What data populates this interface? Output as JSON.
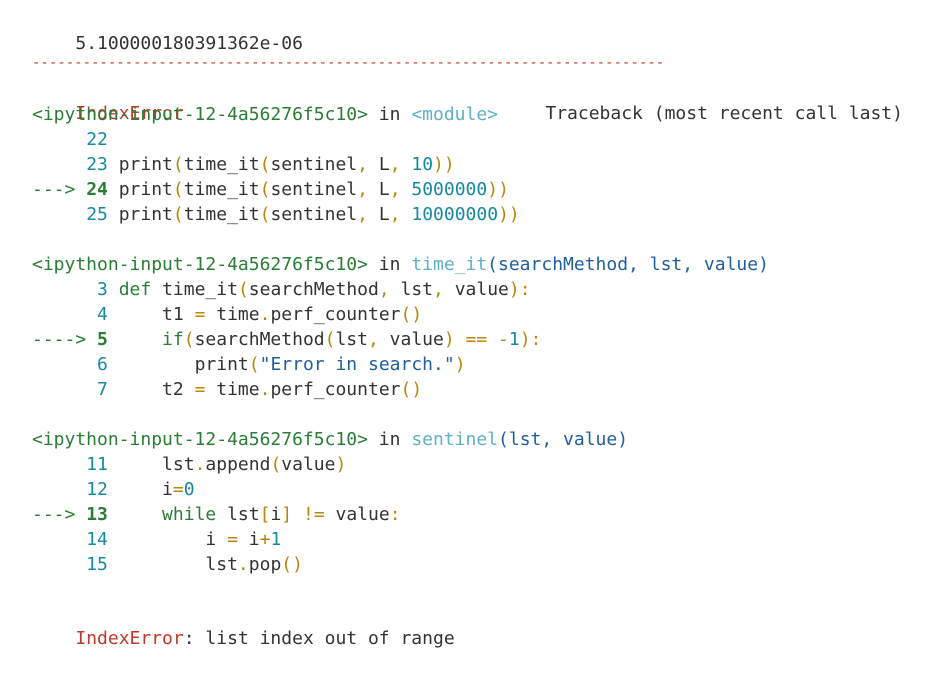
{
  "output": {
    "value": "5.100000180391362e-06"
  },
  "separator": "---------------------------------------------------------------------------",
  "traceback_header": {
    "error_type": "IndexError",
    "title": "Traceback (most recent call last)"
  },
  "frames": [
    {
      "location_line": {
        "cell": "<ipython-input-12-4a56276f5c10>",
        "in": " in ",
        "func": "<module>",
        "sig": ""
      },
      "lines": [
        {
          "arrow": "",
          "number": "22",
          "segments": []
        },
        {
          "arrow": "",
          "number": "23",
          "segments": [
            {
              "text": " print",
              "color": "black"
            },
            {
              "text": "(",
              "color": "orange"
            },
            {
              "text": "time_it",
              "color": "black"
            },
            {
              "text": "(",
              "color": "orange"
            },
            {
              "text": "sentinel",
              "color": "black"
            },
            {
              "text": ",",
              "color": "orange"
            },
            {
              "text": " L",
              "color": "black"
            },
            {
              "text": ",",
              "color": "orange"
            },
            {
              "text": " 10",
              "color": "cyan"
            },
            {
              "text": "))",
              "color": "orange"
            }
          ]
        },
        {
          "arrow": "---> ",
          "number": "24",
          "segments": [
            {
              "text": " print",
              "color": "black"
            },
            {
              "text": "(",
              "color": "orange"
            },
            {
              "text": "time_it",
              "color": "black"
            },
            {
              "text": "(",
              "color": "orange"
            },
            {
              "text": "sentinel",
              "color": "black"
            },
            {
              "text": ",",
              "color": "orange"
            },
            {
              "text": " L",
              "color": "black"
            },
            {
              "text": ",",
              "color": "orange"
            },
            {
              "text": " 5000000",
              "color": "cyan"
            },
            {
              "text": "))",
              "color": "orange"
            }
          ]
        },
        {
          "arrow": "",
          "number": "25",
          "segments": [
            {
              "text": " print",
              "color": "black"
            },
            {
              "text": "(",
              "color": "orange"
            },
            {
              "text": "time_it",
              "color": "black"
            },
            {
              "text": "(",
              "color": "orange"
            },
            {
              "text": "sentinel",
              "color": "black"
            },
            {
              "text": ",",
              "color": "orange"
            },
            {
              "text": " L",
              "color": "black"
            },
            {
              "text": ",",
              "color": "orange"
            },
            {
              "text": " 10000000",
              "color": "cyan"
            },
            {
              "text": "))",
              "color": "orange"
            }
          ]
        }
      ]
    },
    {
      "location_line": {
        "cell": "<ipython-input-12-4a56276f5c10>",
        "in": " in ",
        "func": "time_it",
        "sig": "(searchMethod, lst, value)"
      },
      "lines": [
        {
          "arrow": "",
          "number": "3",
          "segments": [
            {
              "text": " def",
              "color": "green"
            },
            {
              "text": " time_it",
              "color": "black"
            },
            {
              "text": "(",
              "color": "orange"
            },
            {
              "text": "searchMethod",
              "color": "black"
            },
            {
              "text": ",",
              "color": "orange"
            },
            {
              "text": " lst",
              "color": "black"
            },
            {
              "text": ",",
              "color": "orange"
            },
            {
              "text": " value",
              "color": "black"
            },
            {
              "text": "):",
              "color": "orange"
            }
          ]
        },
        {
          "arrow": "",
          "number": "4",
          "segments": [
            {
              "text": "     t1 ",
              "color": "black"
            },
            {
              "text": "=",
              "color": "orange"
            },
            {
              "text": " time",
              "color": "black"
            },
            {
              "text": ".",
              "color": "orange"
            },
            {
              "text": "perf_counter",
              "color": "black"
            },
            {
              "text": "()",
              "color": "orange"
            }
          ]
        },
        {
          "arrow": "----> ",
          "number": "5",
          "segments": [
            {
              "text": "     if",
              "color": "green"
            },
            {
              "text": "(",
              "color": "orange"
            },
            {
              "text": "searchMethod",
              "color": "black"
            },
            {
              "text": "(",
              "color": "orange"
            },
            {
              "text": "lst",
              "color": "black"
            },
            {
              "text": ",",
              "color": "orange"
            },
            {
              "text": " value",
              "color": "black"
            },
            {
              "text": ")",
              "color": "orange"
            },
            {
              "text": " ==",
              "color": "orange"
            },
            {
              "text": " -",
              "color": "orange"
            },
            {
              "text": "1",
              "color": "cyan"
            },
            {
              "text": "):",
              "color": "orange"
            }
          ]
        },
        {
          "arrow": "",
          "number": "6",
          "segments": [
            {
              "text": "        print",
              "color": "black"
            },
            {
              "text": "(",
              "color": "orange"
            },
            {
              "text": "\"Error in search.\"",
              "color": "blue"
            },
            {
              "text": ")",
              "color": "orange"
            }
          ]
        },
        {
          "arrow": "",
          "number": "7",
          "segments": [
            {
              "text": "     t2 ",
              "color": "black"
            },
            {
              "text": "=",
              "color": "orange"
            },
            {
              "text": " time",
              "color": "black"
            },
            {
              "text": ".",
              "color": "orange"
            },
            {
              "text": "perf_counter",
              "color": "black"
            },
            {
              "text": "()",
              "color": "orange"
            }
          ]
        }
      ]
    },
    {
      "location_line": {
        "cell": "<ipython-input-12-4a56276f5c10>",
        "in": " in ",
        "func": "sentinel",
        "sig": "(lst, value)"
      },
      "lines": [
        {
          "arrow": "",
          "number": "11",
          "segments": [
            {
              "text": "     lst",
              "color": "black"
            },
            {
              "text": ".",
              "color": "orange"
            },
            {
              "text": "append",
              "color": "black"
            },
            {
              "text": "(",
              "color": "orange"
            },
            {
              "text": "value",
              "color": "black"
            },
            {
              "text": ")",
              "color": "orange"
            }
          ]
        },
        {
          "arrow": "",
          "number": "12",
          "segments": [
            {
              "text": "     i",
              "color": "black"
            },
            {
              "text": "=",
              "color": "orange"
            },
            {
              "text": "0",
              "color": "cyan"
            }
          ]
        },
        {
          "arrow": "---> ",
          "number": "13",
          "segments": [
            {
              "text": "     while",
              "color": "green"
            },
            {
              "text": " lst",
              "color": "black"
            },
            {
              "text": "[",
              "color": "orange"
            },
            {
              "text": "i",
              "color": "black"
            },
            {
              "text": "]",
              "color": "orange"
            },
            {
              "text": " !=",
              "color": "orange"
            },
            {
              "text": " value",
              "color": "black"
            },
            {
              "text": ":",
              "color": "orange"
            }
          ]
        },
        {
          "arrow": "",
          "number": "14",
          "segments": [
            {
              "text": "         i ",
              "color": "black"
            },
            {
              "text": "=",
              "color": "orange"
            },
            {
              "text": " i",
              "color": "black"
            },
            {
              "text": "+",
              "color": "orange"
            },
            {
              "text": "1",
              "color": "cyan"
            }
          ]
        },
        {
          "arrow": "",
          "number": "15",
          "segments": [
            {
              "text": "         lst",
              "color": "black"
            },
            {
              "text": ".",
              "color": "orange"
            },
            {
              "text": "pop",
              "color": "black"
            },
            {
              "text": "()",
              "color": "orange"
            }
          ]
        }
      ]
    }
  ],
  "final_error": {
    "type": "IndexError",
    "message": ": list index out of range"
  },
  "colors": {
    "red": "#c0392b",
    "green": "#2a7d34",
    "lightcyan": "#5fb1c3",
    "cyan": "#168aa3",
    "blue": "#1f5e9f",
    "orange": "#b8860b",
    "black": "#333333",
    "background": "#ffffff"
  }
}
